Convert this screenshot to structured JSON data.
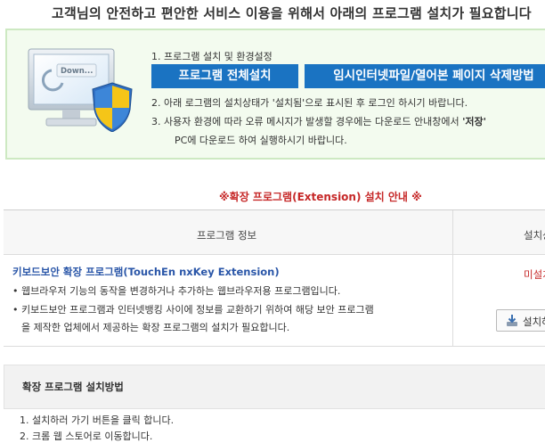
{
  "headline": "고객님의 안전하고 편안한 서비스 이용을 위해서 아래의 프로그램 설치가 필요합니다",
  "setup": {
    "step1_label": "1. 프로그램 설치 및 환경설정",
    "btn_install_all": "프로그램 전체설치",
    "btn_delete_temp": "임시인터넷파일/열어본 페이지 삭제방법",
    "step2_text": "2. 아래 로그램의 설치상태가 '설치됨'으로 표시된 후 로그인 하시기 바랍니다.",
    "step3_text_a": "3. 사용자 환경에 따라 오류 메시지가 발생할 경우에는 다운로드 안내창에서 ",
    "step3_bold": "'저장'",
    "step3_text_b": "PC에 다운로드 하여 실행하시기 바랍니다.",
    "monitor_caption": "Down..."
  },
  "notice_title": "※확장 프로그램(Extension) 설치 안내 ※",
  "table": {
    "col_info": "프로그램 정보",
    "col_status": "설치상태",
    "rows": [
      {
        "name": "키보드보안 확장 프로그램(TouchEn nxKey Extension)",
        "desc1": "• 웹브라우저 기능의 동작을 변경하거나 추가하는 웹브라우저용 프로그램입니다.",
        "desc2": "• 키보드보안 프로그램과 인터넷뱅킹 사이에 정보를 교환하기 위하여 해당 보안 프로그램",
        "desc3": "을 제작한 업체에서 제공하는 확장 프로그램의 설치가 필요합니다.",
        "status": "미설치",
        "install_label": "설치하기"
      }
    ]
  },
  "method": {
    "title": "확장 프로그램 설치방법",
    "step1": "1. 설치하러 가기 버튼을 클릭 합니다.",
    "step2": "2. 크롬 웹 스토어로 이동합니다."
  },
  "colors": {
    "accent_blue": "#1a73c2",
    "link_blue": "#2a56a8",
    "alert_red": "#c62828",
    "panel_green": "#f3fbef"
  }
}
